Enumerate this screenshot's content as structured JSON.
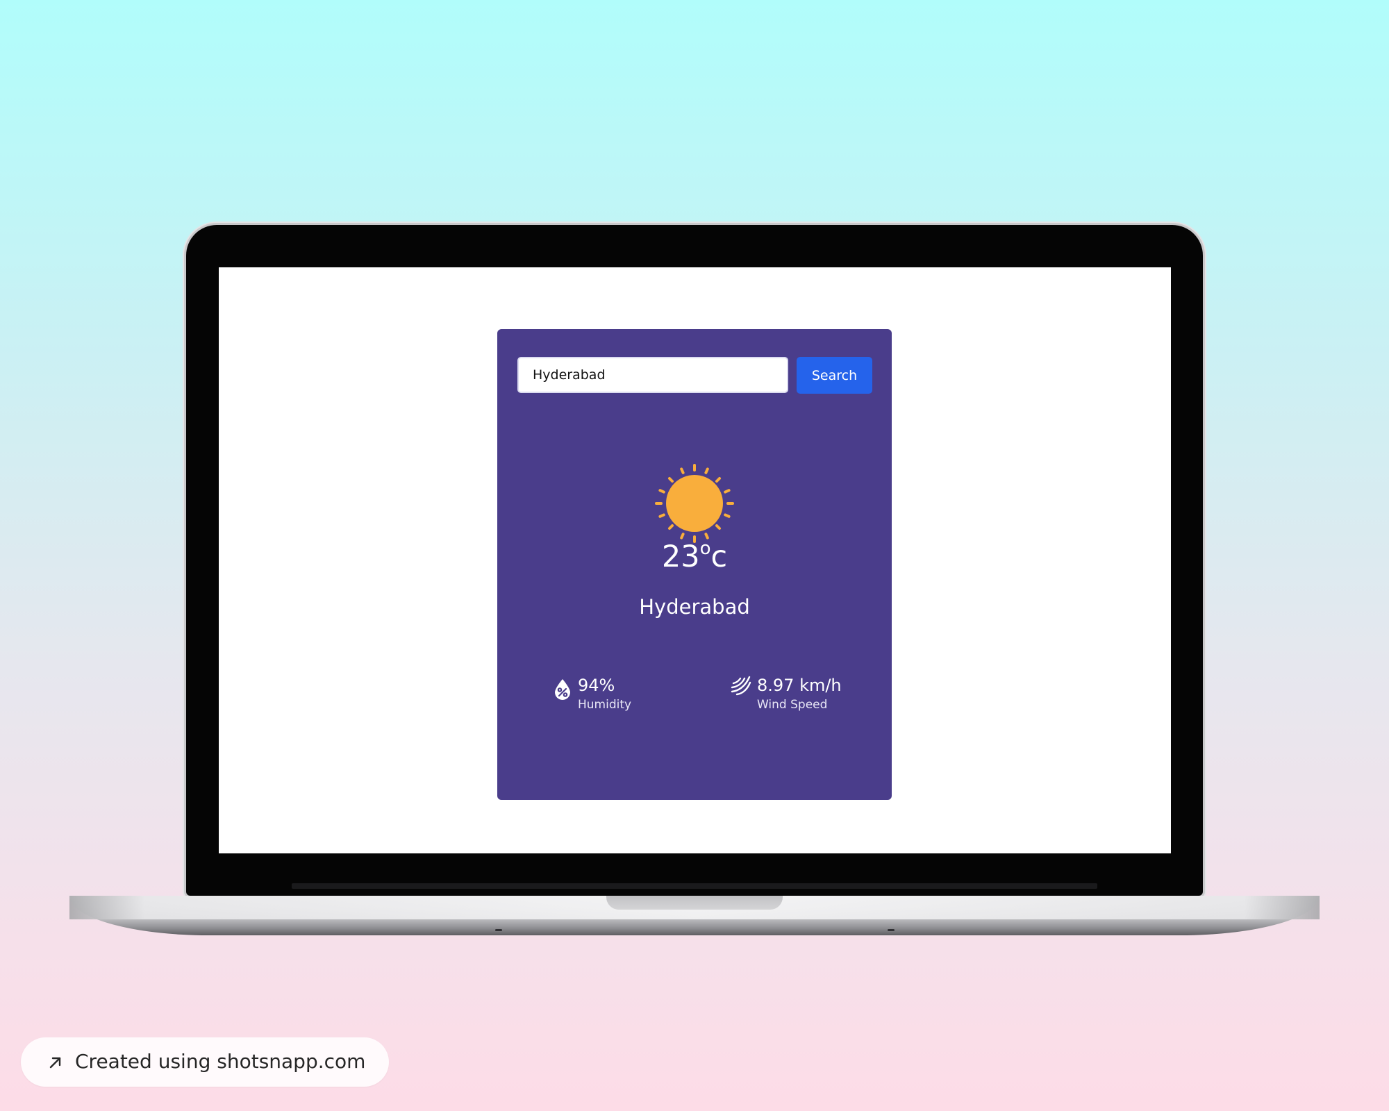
{
  "weather_app": {
    "search": {
      "value": "Hyderabad",
      "button_label": "Search"
    },
    "condition_icon": "sun-icon",
    "temperature": {
      "value": "23",
      "unit": "c",
      "degree_symbol": "o"
    },
    "city": "Hyderabad",
    "stats": {
      "humidity": {
        "value": "94%",
        "label": "Humidity",
        "icon": "humidity-icon"
      },
      "wind": {
        "value": "8.97 km/h",
        "label": "Wind Speed",
        "icon": "wind-icon"
      }
    }
  },
  "footer_badge": {
    "text": "Created using shotsnapp.com",
    "icon": "arrow-up-right-icon"
  },
  "colors": {
    "card_background": "#4a3d8b",
    "button_blue": "#2563eb",
    "sun_orange": "#f9ae3c"
  }
}
